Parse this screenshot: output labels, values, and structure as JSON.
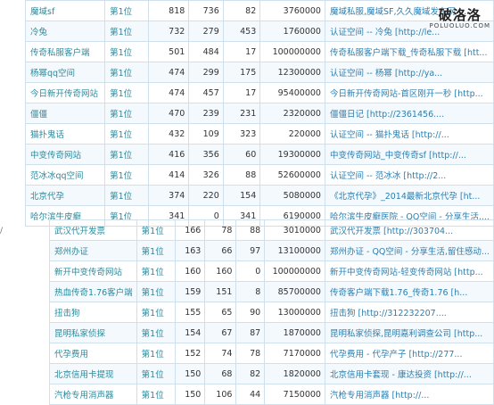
{
  "watermark": {
    "main": "破洛洛",
    "sub": "POLUOLUO.COM"
  },
  "edge_mark": "/",
  "table_top": {
    "rows": [
      {
        "kw": "魔域sf",
        "rank": "第1位",
        "a": "818",
        "b": "736",
        "c": "82",
        "d": "3760000",
        "desc": "魔域私服,魔域SF,久久魔域发布网 | ..."
      },
      {
        "kw": "冷兔",
        "rank": "第1位",
        "a": "732",
        "b": "279",
        "c": "453",
        "d": "1760000",
        "desc": "认证空间 -- 冷兔 [http://le..."
      },
      {
        "kw": "传奇私服客户端",
        "rank": "第1位",
        "a": "501",
        "b": "484",
        "c": "17",
        "d": "100000000",
        "desc": "传奇私服客户端下载_传奇私服下载 [htt..."
      },
      {
        "kw": "杨幂qq空间",
        "rank": "第1位",
        "a": "474",
        "b": "299",
        "c": "175",
        "d": "12300000",
        "desc": "认证空间 -- 杨幂 [http://ya..."
      },
      {
        "kw": "今日新开传奇网站",
        "rank": "第1位",
        "a": "474",
        "b": "457",
        "c": "17",
        "d": "95400000",
        "desc": "今日新开传奇网站-首区刚开一秒 [http..."
      },
      {
        "kw": "僵僵",
        "rank": "第1位",
        "a": "470",
        "b": "239",
        "c": "231",
        "d": "2320000",
        "desc": "僵僵日记 [http://2361456...."
      },
      {
        "kw": "猫扑鬼话",
        "rank": "第1位",
        "a": "432",
        "b": "109",
        "c": "323",
        "d": "220000",
        "desc": "认证空间 -- 猫扑鬼话 [http://..."
      },
      {
        "kw": "中变传奇网站",
        "rank": "第1位",
        "a": "416",
        "b": "356",
        "c": "60",
        "d": "19300000",
        "desc": "中变传奇网站_中变传奇sf [http://..."
      },
      {
        "kw": "范冰冰qq空间",
        "rank": "第1位",
        "a": "414",
        "b": "326",
        "c": "88",
        "d": "52600000",
        "desc": "认证空间 -- 范冰冰 [http://2..."
      },
      {
        "kw": "北京代孕",
        "rank": "第1位",
        "a": "374",
        "b": "220",
        "c": "154",
        "d": "5080000",
        "desc": "《北京代孕》_2014最新北京代孕 [ht..."
      },
      {
        "kw": "哈尔滨牛皮癣",
        "rank": "第1位",
        "a": "341",
        "b": "0",
        "c": "341",
        "d": "6190000",
        "desc": "哈尔滨牛皮癣医院 - QQ空间 - 分享生活,..."
      }
    ]
  },
  "table_bottom": {
    "rows": [
      {
        "kw": "武汉代开发票",
        "rank": "第1位",
        "a": "166",
        "b": "78",
        "c": "88",
        "d": "3010000",
        "desc": "武汉代开发票 [http://303704..."
      },
      {
        "kw": "郑州办证",
        "rank": "第1位",
        "a": "163",
        "b": "66",
        "c": "97",
        "d": "13100000",
        "desc": "郑州办证 - QQ空间 - 分享生活,留住感动..."
      },
      {
        "kw": "新开中变传奇网站",
        "rank": "第1位",
        "a": "160",
        "b": "160",
        "c": "0",
        "d": "100000000",
        "desc": "新开中变传奇网站-轻变传奇网站 [http..."
      },
      {
        "kw": "热血传奇1.76客户端",
        "rank": "第1位",
        "a": "159",
        "b": "151",
        "c": "8",
        "d": "85700000",
        "desc": "传奇客户端下载1.76_传奇1.76 [h..."
      },
      {
        "kw": "扭击狗",
        "rank": "第1位",
        "a": "155",
        "b": "65",
        "c": "90",
        "d": "13000000",
        "desc": "扭击狗 [http://312232207...."
      },
      {
        "kw": "昆明私家侦探",
        "rank": "第1位",
        "a": "154",
        "b": "67",
        "c": "87",
        "d": "1870000",
        "desc": "昆明私家侦探,昆明嘉利调查公司 [http..."
      },
      {
        "kw": "代孕费用",
        "rank": "第1位",
        "a": "152",
        "b": "74",
        "c": "78",
        "d": "7170000",
        "desc": "代孕费用 - 代孕产子 [http://277..."
      },
      {
        "kw": "北京信用卡提现",
        "rank": "第1位",
        "a": "150",
        "b": "68",
        "c": "82",
        "d": "1820000",
        "desc": "北京信用卡套现 - 康达投资 [http://..."
      },
      {
        "kw": "汽枪专用消声器",
        "rank": "第1位",
        "a": "150",
        "b": "106",
        "c": "44",
        "d": "7150000",
        "desc": "汽枪专用消声器 [http://..."
      }
    ]
  }
}
